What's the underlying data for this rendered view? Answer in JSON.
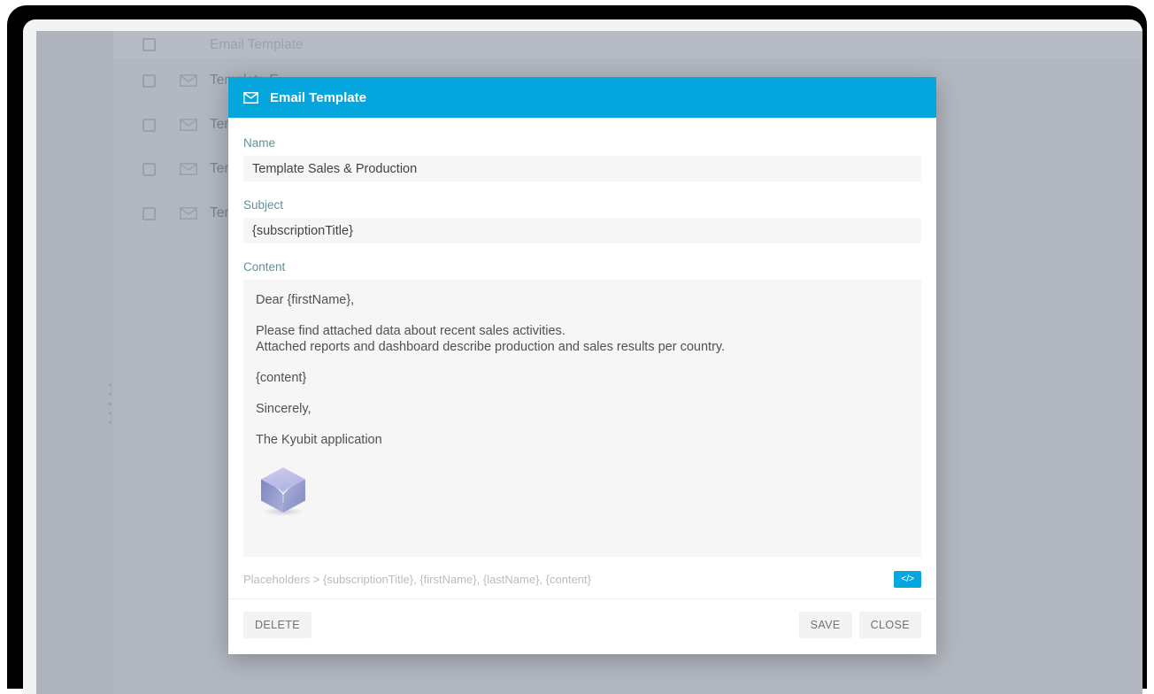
{
  "background_list": {
    "header_row": {
      "label": "Email Template"
    },
    "rows": [
      {
        "label": "Template E",
        "icon": "mail-icon"
      },
      {
        "label": "Template f",
        "icon": "mail-icon"
      },
      {
        "label": "Template S",
        "icon": "mail-icon"
      },
      {
        "label": "Templete H",
        "icon": "mail-icon"
      }
    ]
  },
  "modal": {
    "header": {
      "icon": "mail-icon",
      "title": "Email Template",
      "accent_color": "#05a5de"
    },
    "name_field": {
      "label": "Name",
      "value": "Template Sales & Production",
      "placeholder": ""
    },
    "subject_field": {
      "label": "Subject",
      "value": "{subscriptionTitle}",
      "placeholder": ""
    },
    "content_field": {
      "label": "Content",
      "lines": {
        "greeting": "Dear {firstName},",
        "body_1": "Please find attached data about recent sales activities.",
        "body_2": "Attached reports and dashboard describe production and sales results per country.",
        "placeholder_token": "{content}",
        "closing": "Sincerely,",
        "signature": "The Kyubit application"
      },
      "image": "kyubit-cube-logo"
    },
    "placeholders_hint": "Placeholders > {subscriptionTitle}, {firstName}, {lastName}, {content}",
    "code_button": {
      "label": "</>",
      "icon": "code-icon"
    },
    "footer": {
      "delete_label": "DELETE",
      "save_label": "SAVE",
      "close_label": "CLOSE"
    }
  }
}
